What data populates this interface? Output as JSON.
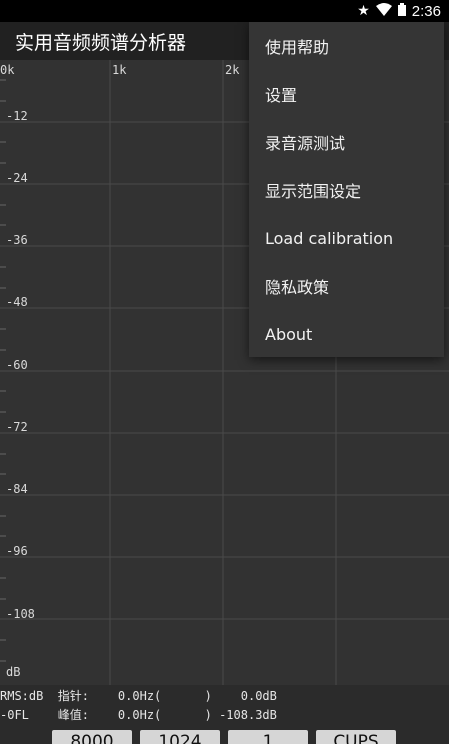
{
  "status_bar": {
    "time": "2:36",
    "icons": [
      "star-icon",
      "wifi-icon",
      "battery-icon"
    ]
  },
  "app": {
    "title": "实用音频频谱分析器"
  },
  "plot": {
    "x_ticks": [
      "0k",
      "1k",
      "2k"
    ],
    "y_ticks": [
      "-12",
      "-24",
      "-36",
      "-48",
      "-60",
      "-72",
      "-84",
      "-96",
      "-108"
    ],
    "y_unit": "dB"
  },
  "readout": {
    "row1": "RMS:dB  指针:    0.0Hz(      )    0.0dB",
    "row2": "-0FL    峰值:    0.0Hz(      ) -108.3dB"
  },
  "buttons": [
    "8000",
    "1024",
    "1",
    "CUPS"
  ],
  "menu": {
    "items": [
      "使用帮助",
      "设置",
      "录音源测试",
      "显示范围设定",
      "Load calibration",
      "隐私政策",
      "About"
    ]
  },
  "colors": {
    "background": "#323232",
    "app_bar": "#212121",
    "menu": "#353535",
    "grid": "#4a4a4a"
  }
}
